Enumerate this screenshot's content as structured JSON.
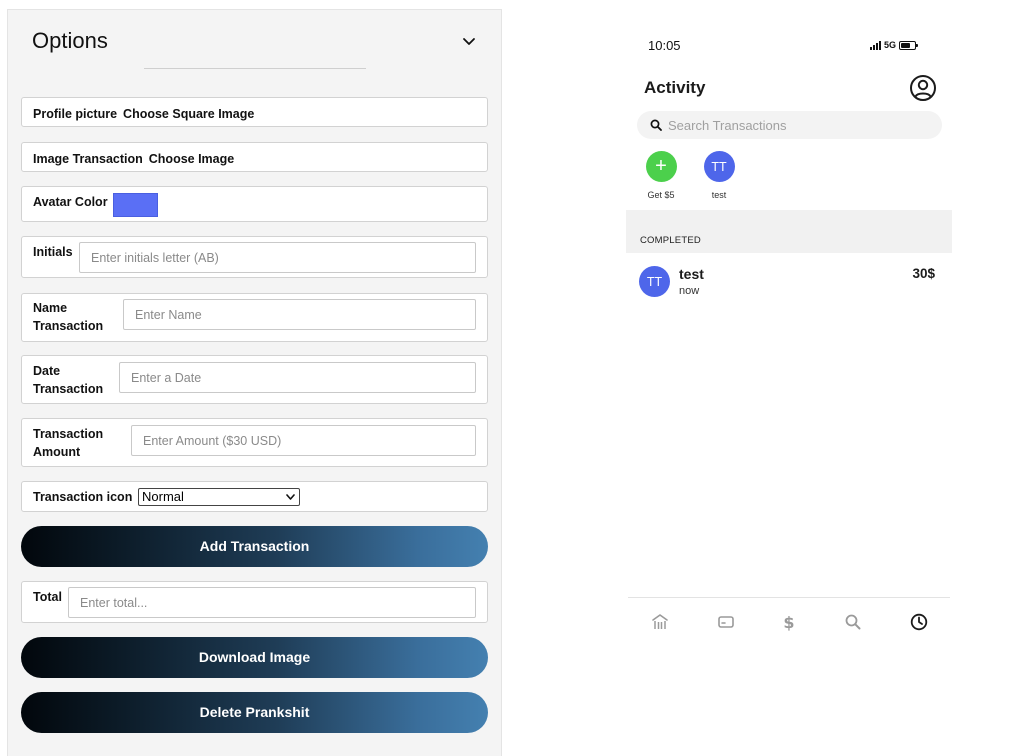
{
  "options": {
    "title": "Options",
    "profile_picture": {
      "label": "Profile picture",
      "action": "Choose Square Image"
    },
    "image_transaction": {
      "label": "Image Transaction",
      "action": "Choose Image"
    },
    "avatar_color": {
      "label": "Avatar Color",
      "value": "#5a6ff5"
    },
    "initials": {
      "label": "Initials",
      "placeholder": "Enter initials letter (AB)",
      "value": ""
    },
    "name_transaction": {
      "label_line1": "Name",
      "label_line2": "Transaction",
      "placeholder": "Enter Name",
      "value": ""
    },
    "date_transaction": {
      "label_line1": "Date",
      "label_line2": "Transaction",
      "placeholder": "Enter a Date",
      "value": ""
    },
    "transaction_amount": {
      "label_line1": "Transaction",
      "label_line2": "Amount",
      "placeholder": "Enter Amount ($30 USD)",
      "value": ""
    },
    "transaction_icon": {
      "label": "Transaction icon",
      "selected": "Normal"
    },
    "add_transaction_label": "Add Transaction",
    "total": {
      "label": "Total",
      "placeholder": "Enter total...",
      "value": ""
    },
    "download_image_label": "Download Image",
    "delete_label": "Delete Prankshit"
  },
  "phone": {
    "status": {
      "time": "10:05",
      "network": "5G"
    },
    "header": {
      "title": "Activity"
    },
    "search": {
      "placeholder": "Search Transactions"
    },
    "contacts": [
      {
        "initials": "+",
        "name": "Get $5",
        "color": "#4cd04c"
      },
      {
        "initials": "TT",
        "name": "test",
        "color": "#4e66ea"
      }
    ],
    "section_label": "COMPLETED",
    "transactions": [
      {
        "initials": "TT",
        "name": "test",
        "time": "now",
        "amount": "30$"
      }
    ],
    "nav": [
      "home-icon",
      "card-icon",
      "dollar-icon",
      "search-icon",
      "clock-icon"
    ]
  },
  "colors": {
    "button_gradient_start": "#02070c",
    "button_gradient_end": "#4480b0",
    "avatar_blue": "#4e66ea",
    "plus_green": "#4cd04c"
  }
}
